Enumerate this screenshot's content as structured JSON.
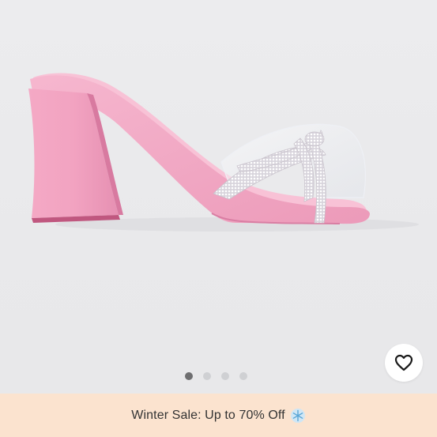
{
  "product": {
    "image_alt": "Pink block-heel slide sandal with clear vinyl strap and rhinestone crossover straps",
    "favorite_icon": "heart-outline-icon"
  },
  "carousel": {
    "total": 4,
    "active_index": 0
  },
  "promo": {
    "text": "Winter Sale: Up to 70% Off",
    "icon": "snowflake-icon"
  },
  "colors": {
    "background": "#ebebed",
    "sandal_pink": "#f2a9c4",
    "promo_bg": "#fbe3cf",
    "dot_active": "#6e6e70",
    "dot_inactive": "#cfd0d3"
  }
}
